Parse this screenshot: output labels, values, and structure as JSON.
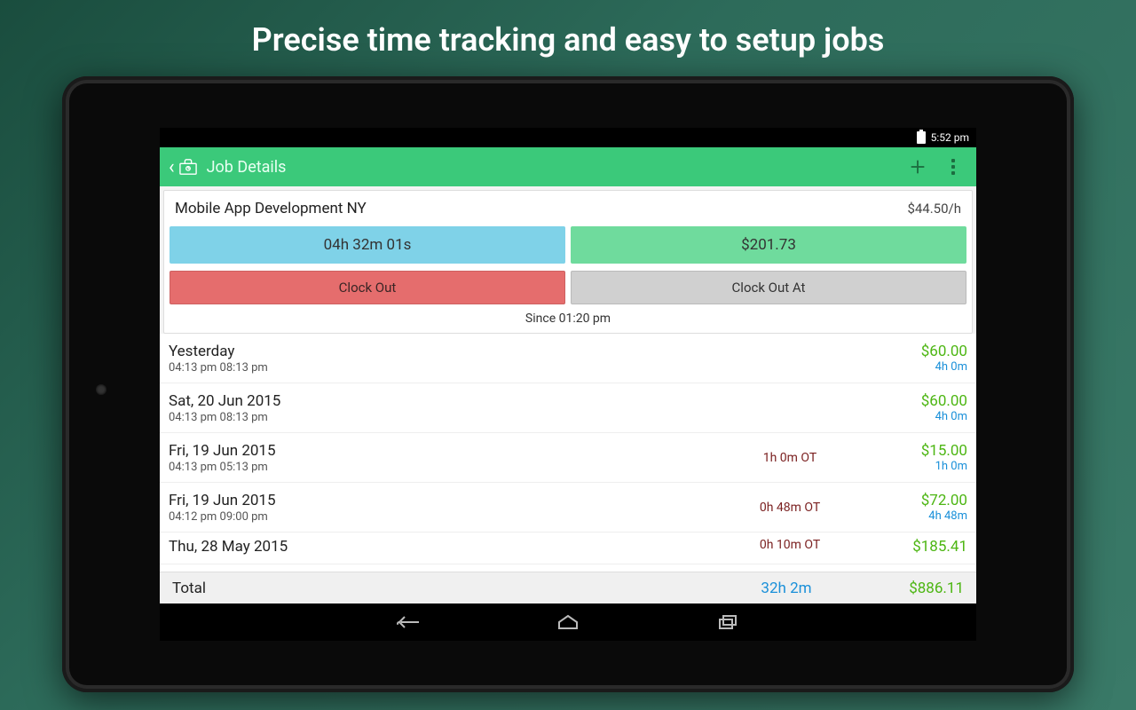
{
  "promo": {
    "title": "Precise time tracking and easy to setup jobs"
  },
  "status": {
    "time": "5:52 pm"
  },
  "header": {
    "title": "Job Details"
  },
  "job": {
    "name": "Mobile App Development NY",
    "rate": "$44.50/h",
    "elapsed": "04h 32m 01s",
    "earned": "$201.73",
    "clock_out_label": "Clock Out",
    "clock_out_at_label": "Clock Out At",
    "since": "Since 01:20 pm"
  },
  "entries": [
    {
      "date": "Yesterday",
      "times": "04:13 pm  08:13 pm",
      "ot": "",
      "amount": "$60.00",
      "duration": "4h 0m"
    },
    {
      "date": "Sat, 20 Jun 2015",
      "times": "04:13 pm  08:13 pm",
      "ot": "",
      "amount": "$60.00",
      "duration": "4h 0m"
    },
    {
      "date": "Fri, 19 Jun 2015",
      "times": "04:13 pm  05:13 pm",
      "ot": "1h 0m OT",
      "amount": "$15.00",
      "duration": "1h 0m"
    },
    {
      "date": "Fri, 19 Jun 2015",
      "times": "04:12 pm  09:00 pm",
      "ot": "0h 48m OT",
      "amount": "$72.00",
      "duration": "4h 48m"
    },
    {
      "date": "Thu, 28 May 2015",
      "times": "",
      "ot": "0h 10m OT",
      "amount": "$185.41",
      "duration": ""
    }
  ],
  "total": {
    "label": "Total",
    "time": "32h 2m",
    "amount": "$886.11"
  }
}
